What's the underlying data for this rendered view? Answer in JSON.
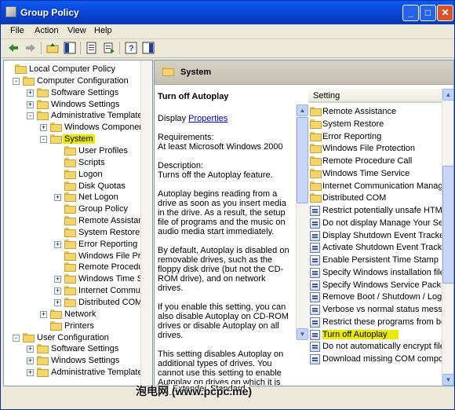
{
  "window": {
    "title": "Group Policy",
    "min": "_",
    "max": "□",
    "close": "✕"
  },
  "menu": [
    "File",
    "Action",
    "View",
    "Help"
  ],
  "toolbar": [
    "back-arrow-icon",
    "forward-arrow-icon",
    "up-folder-icon",
    "show-hide-tree-icon",
    "properties-icon",
    "export-list-icon",
    "help-icon",
    "show-hide-action-pane-icon"
  ],
  "tree": [
    {
      "label": "Local Computer Policy",
      "depth": 0,
      "expand": ""
    },
    {
      "label": "Computer Configuration",
      "depth": 1,
      "expand": "-"
    },
    {
      "label": "Software Settings",
      "depth": 2,
      "expand": "+"
    },
    {
      "label": "Windows Settings",
      "depth": 2,
      "expand": "+"
    },
    {
      "label": "Administrative Templates",
      "depth": 2,
      "expand": "-"
    },
    {
      "label": "Windows Components",
      "depth": 3,
      "expand": "+"
    },
    {
      "label": "System",
      "depth": 3,
      "expand": "-",
      "selected": true
    },
    {
      "label": "User Profiles",
      "depth": 4,
      "expand": ""
    },
    {
      "label": "Scripts",
      "depth": 4,
      "expand": ""
    },
    {
      "label": "Logon",
      "depth": 4,
      "expand": ""
    },
    {
      "label": "Disk Quotas",
      "depth": 4,
      "expand": ""
    },
    {
      "label": "Net Logon",
      "depth": 4,
      "expand": "+"
    },
    {
      "label": "Group Policy",
      "depth": 4,
      "expand": ""
    },
    {
      "label": "Remote Assistance",
      "depth": 4,
      "expand": ""
    },
    {
      "label": "System Restore",
      "depth": 4,
      "expand": ""
    },
    {
      "label": "Error Reporting",
      "depth": 4,
      "expand": "+"
    },
    {
      "label": "Windows File Protect",
      "depth": 4,
      "expand": ""
    },
    {
      "label": "Remote Procedure C",
      "depth": 4,
      "expand": ""
    },
    {
      "label": "Windows Time Servic",
      "depth": 4,
      "expand": "+"
    },
    {
      "label": "Internet Communica",
      "depth": 4,
      "expand": "+"
    },
    {
      "label": "Distributed COM",
      "depth": 4,
      "expand": "+"
    },
    {
      "label": "Network",
      "depth": 3,
      "expand": "+"
    },
    {
      "label": "Printers",
      "depth": 3,
      "expand": ""
    },
    {
      "label": "User Configuration",
      "depth": 1,
      "expand": "-"
    },
    {
      "label": "Software Settings",
      "depth": 2,
      "expand": "+"
    },
    {
      "label": "Windows Settings",
      "depth": 2,
      "expand": "+"
    },
    {
      "label": "Administrative Templates",
      "depth": 2,
      "expand": "+"
    }
  ],
  "pane_header": "System",
  "description": {
    "title": "Turn off Autoplay",
    "display_prefix": "Display ",
    "display_link": "Properties",
    "requirements_label": "Requirements:",
    "requirements": "At least Microsoft Windows 2000",
    "description_label": "Description:",
    "description": "Turns off the Autoplay feature.",
    "p1": "Autoplay begins reading from a drive as soon as you insert media in the drive. As a result, the setup file of programs and the music on audio media start immediately.",
    "p2": "By default, Autoplay is disabled on removable drives, such as the floppy disk drive (but not the CD-ROM drive), and on network drives.",
    "p3": "If you enable this setting, you can also disable Autoplay on CD-ROM drives or disable Autoplay on all drives.",
    "p4": "This setting disables Autoplay on additional types of drives. You cannot use this setting to enable Autoplay on drives on which it is disabled by"
  },
  "list_header": "Setting",
  "list": [
    {
      "label": "Remote Assistance",
      "kind": "folder"
    },
    {
      "label": "System Restore",
      "kind": "folder"
    },
    {
      "label": "Error Reporting",
      "kind": "folder"
    },
    {
      "label": "Windows File Protection",
      "kind": "folder"
    },
    {
      "label": "Remote Procedure Call",
      "kind": "folder"
    },
    {
      "label": "Windows Time Service",
      "kind": "folder"
    },
    {
      "label": "Internet Communication Managem",
      "kind": "folder"
    },
    {
      "label": "Distributed COM",
      "kind": "folder"
    },
    {
      "label": "Restrict potentially unsafe HTML Help",
      "kind": "policy"
    },
    {
      "label": "Do not display Manage Your Server",
      "kind": "policy"
    },
    {
      "label": "Display Shutdown Event Tracker",
      "kind": "policy"
    },
    {
      "label": "Activate Shutdown Event Tracker",
      "kind": "policy"
    },
    {
      "label": "Enable Persistent Time Stamp",
      "kind": "policy"
    },
    {
      "label": "Specify Windows installation file lo",
      "kind": "policy"
    },
    {
      "label": "Specify Windows Service Pack insta",
      "kind": "policy"
    },
    {
      "label": "Remove Boot / Shutdown / Logon",
      "kind": "policy"
    },
    {
      "label": "Verbose vs normal status messages",
      "kind": "policy"
    },
    {
      "label": "Restrict these programs from being",
      "kind": "policy"
    },
    {
      "label": "Turn off Autoplay",
      "kind": "policy",
      "selected": true
    },
    {
      "label": "Do not automatically encrypt files",
      "kind": "policy"
    },
    {
      "label": "Download missing COM componer",
      "kind": "policy"
    }
  ],
  "tabs": [
    "Extended",
    "Standard"
  ],
  "watermark": "泡电网 (www.pcpc.me)"
}
